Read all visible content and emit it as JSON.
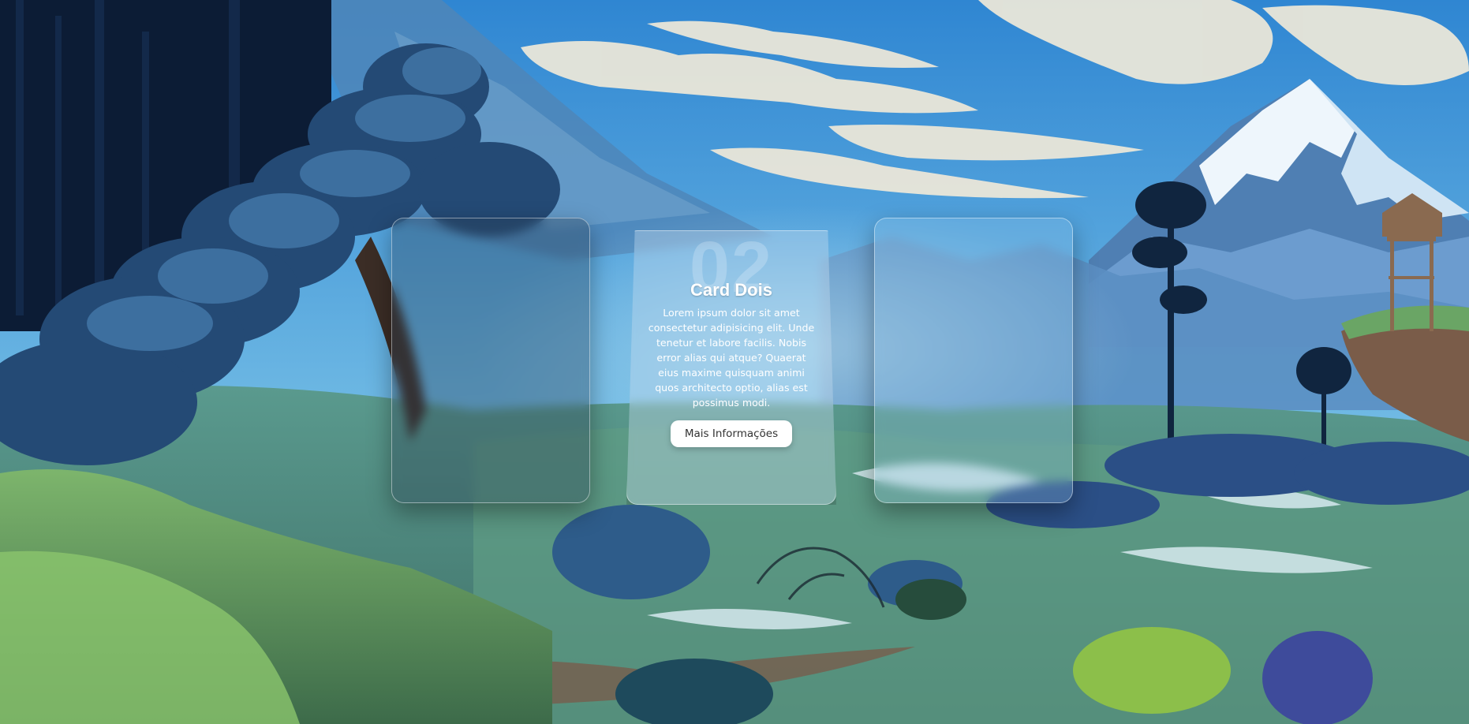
{
  "background": {
    "description_icon": "landscape-illustration",
    "colors": {
      "sky_top": "#3b8fd6",
      "sky_bottom": "#9cd4ea",
      "mountain": "#e6f2fb",
      "forest_dark": "#0d1e36",
      "meadow": "#4e8a7a",
      "grass": "#6fa35a"
    }
  },
  "cards": [
    {
      "id": "card-one",
      "number": "",
      "title": "",
      "text": "",
      "button": ""
    },
    {
      "id": "card-two",
      "number": "02",
      "title": "Card Dois",
      "text": "Lorem ipsum dolor sit amet consectetur adipisicing elit. Unde tenetur et labore facilis. Nobis error alias qui atque? Quaerat eius maxime quisquam animi quos architecto optio, alias est possimus modi.",
      "button": "Mais Informações"
    },
    {
      "id": "card-three",
      "number": "",
      "title": "",
      "text": "",
      "button": ""
    }
  ]
}
